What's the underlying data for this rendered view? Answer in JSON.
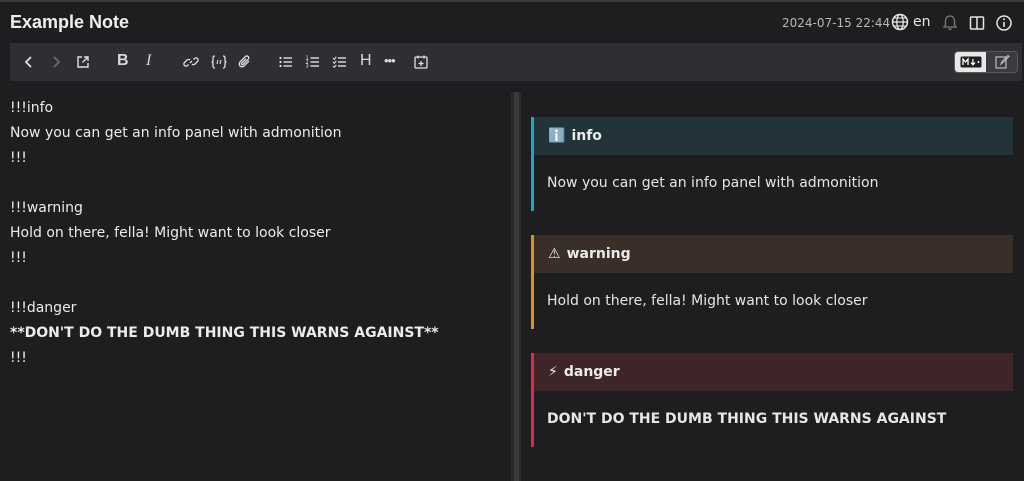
{
  "window": {
    "title": "Example Note",
    "timestamp": "2024-07-15 22:44",
    "language": "en"
  },
  "toolbar": {
    "bold_label": "B",
    "italic_label": "I",
    "heading_label": "H",
    "more_label": "•••"
  },
  "editor": {
    "lines": [
      "!!!info",
      "Now you can get an info panel with admonition",
      "!!!",
      "",
      "!!!warning",
      "Hold on there, fella! Might want to look closer",
      "!!!",
      "",
      "!!!danger",
      "**DON'T DO THE DUMB THING THIS WARNS AGAINST**",
      "!!!"
    ]
  },
  "preview": {
    "admonitions": [
      {
        "type": "info",
        "title": "info",
        "icon": "ℹ️",
        "body": "Now you can get an info panel with admonition",
        "accent": "#19a9c4",
        "head_bg": "#22333a",
        "body_bold": false
      },
      {
        "type": "warning",
        "title": "warning",
        "icon": "⚠",
        "body": "Hold on there, fella! Might want to look closer",
        "accent": "#e38f1f",
        "head_bg": "#3a2f28",
        "body_bold": false
      },
      {
        "type": "danger",
        "title": "danger",
        "icon": "⚡",
        "body": "DON'T DO THE DUMB THING THIS WARNS AGAINST",
        "accent": "#e02a4a",
        "head_bg": "#3d2528",
        "body_bold": true
      }
    ]
  },
  "colors": {
    "background": "#1e1e20",
    "toolbar": "#2e2f33"
  }
}
